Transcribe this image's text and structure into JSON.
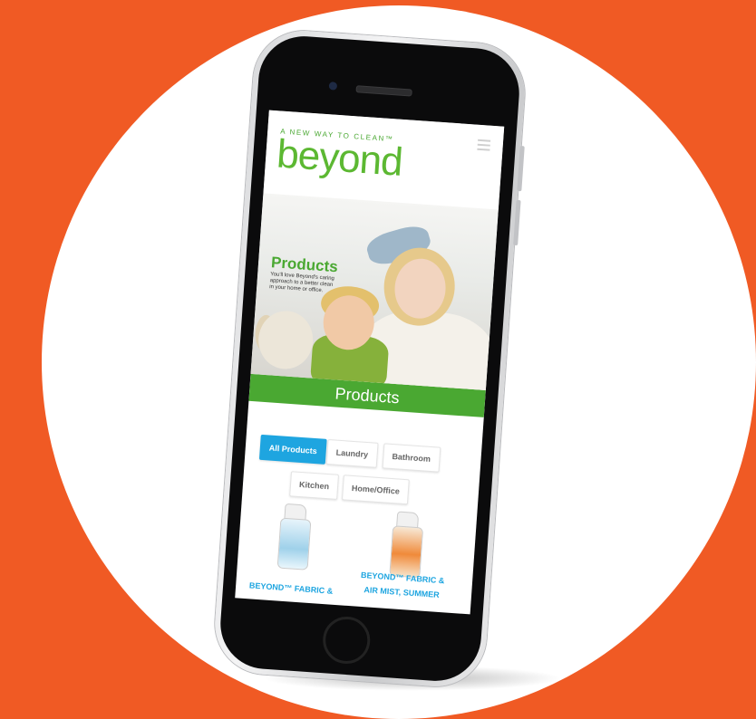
{
  "site": {
    "tagline": "A NEW WAY TO CLEAN™",
    "logo": "beyond"
  },
  "hero": {
    "title": "Products",
    "text": "You'll love Beyond's caring approach to a better clean in your home or office."
  },
  "section_title": "Products",
  "filters": [
    {
      "label": "All Products",
      "active": true
    },
    {
      "label": "Laundry",
      "active": false
    },
    {
      "label": "Bathroom",
      "active": false
    },
    {
      "label": "Kitchen",
      "active": false
    },
    {
      "label": "Home/Office",
      "active": false
    }
  ],
  "products": [
    {
      "name_line1": "BEYOND™ FABRIC &",
      "name_line2": ""
    },
    {
      "name_line1": "BEYOND™ FABRIC &",
      "name_line2": "AIR MIST, SUMMER"
    }
  ],
  "colors": {
    "background": "#f05a24",
    "brand_green": "#4aa832",
    "accent_blue": "#1ea5e0"
  },
  "icons": {
    "menu": "hamburger-icon"
  }
}
